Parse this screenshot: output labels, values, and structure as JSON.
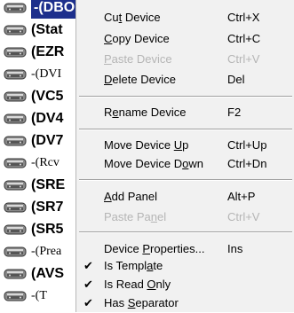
{
  "tree_items": [
    {
      "label": "-(DBO",
      "selected": true,
      "style": "bold"
    },
    {
      "label": "(Stat",
      "selected": false,
      "style": "bold"
    },
    {
      "label": "(EZR",
      "selected": false,
      "style": "bold"
    },
    {
      "label": "-(DVI",
      "selected": false,
      "style": "serif"
    },
    {
      "label": "(VC5",
      "selected": false,
      "style": "bold"
    },
    {
      "label": "(DV4",
      "selected": false,
      "style": "bold"
    },
    {
      "label": "(DV7",
      "selected": false,
      "style": "bold"
    },
    {
      "label": "-(Rcv",
      "selected": false,
      "style": "serif"
    },
    {
      "label": "(SRE",
      "selected": false,
      "style": "bold"
    },
    {
      "label": "(SR7",
      "selected": false,
      "style": "bold"
    },
    {
      "label": "(SR5",
      "selected": false,
      "style": "bold"
    },
    {
      "label": "-(Prea",
      "selected": false,
      "style": "serif"
    },
    {
      "label": "(AVS",
      "selected": false,
      "style": "bold"
    },
    {
      "label": "-(T",
      "selected": false,
      "style": "serif"
    }
  ],
  "menu": {
    "cut": {
      "pre": "Cu",
      "u": "t",
      "post": " Device",
      "shortcut": "Ctrl+X"
    },
    "copy": {
      "pre": "",
      "u": "C",
      "post": "opy Device",
      "shortcut": "Ctrl+C"
    },
    "paste": {
      "pre": "",
      "u": "P",
      "post": "aste Device",
      "shortcut": "Ctrl+V"
    },
    "delete": {
      "pre": "",
      "u": "D",
      "post": "elete Device",
      "shortcut": "Del"
    },
    "rename": {
      "pre": "R",
      "u": "e",
      "post": "name Device",
      "shortcut": "F2"
    },
    "move_up": {
      "pre": "Move Device ",
      "u": "U",
      "post": "p",
      "shortcut": "Ctrl+Up"
    },
    "move_down": {
      "pre": "Move Device D",
      "u": "o",
      "post": "wn",
      "shortcut": "Ctrl+Dn"
    },
    "add_panel": {
      "pre": "",
      "u": "A",
      "post": "dd Panel",
      "shortcut": "Alt+P"
    },
    "paste_panel": {
      "pre": "Paste Pa",
      "u": "n",
      "post": "el",
      "shortcut": "Ctrl+V"
    },
    "properties": {
      "pre": "Device ",
      "u": "P",
      "post": "roperties...",
      "shortcut": "Ins"
    },
    "is_template": {
      "pre": "Is Templ",
      "u": "a",
      "post": "te",
      "checked": true
    },
    "is_read_only": {
      "pre": "Is Read ",
      "u": "O",
      "post": "nly",
      "checked": true
    },
    "has_separator": {
      "pre": "Has ",
      "u": "S",
      "post": "eparator",
      "checked": true
    }
  },
  "colors": {
    "selection": "#1d2f8c",
    "menu_bg": "#f1f1f1",
    "disabled_text": "#b5b5b5"
  },
  "icons": {
    "device": "device-rack-icon",
    "check": "checkmark-icon"
  }
}
